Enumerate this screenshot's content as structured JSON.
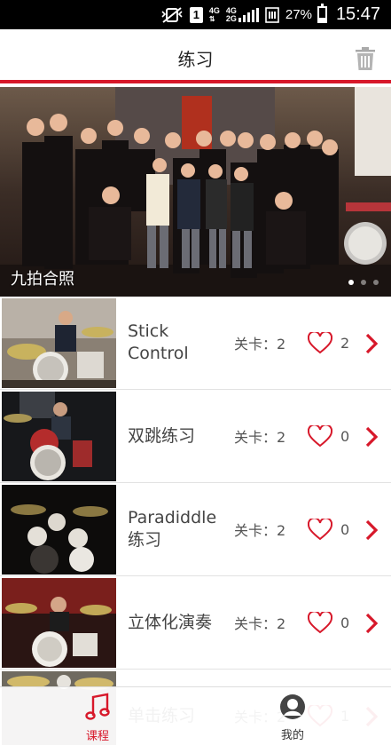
{
  "status_bar": {
    "sim_slot": "1",
    "network_top": "4G",
    "network_right_top": "4G",
    "network_right_bottom": "2G",
    "battery_percent": "27%",
    "time": "15:47",
    "battery_level": 0.27
  },
  "header": {
    "title": "练习",
    "trash_icon": "trash-icon"
  },
  "banner": {
    "caption": "九拍合照",
    "page_count": 3,
    "active_page": 1
  },
  "courses": [
    {
      "name": "Stick Control",
      "level_label": "关卡：2",
      "likes": "2"
    },
    {
      "name": "双跳练习",
      "level_label": "关卡：2",
      "likes": "0"
    },
    {
      "name": "Paradiddle 练习",
      "level_label": "关卡：2",
      "likes": "0"
    },
    {
      "name": "立体化演奏",
      "level_label": "关卡：2",
      "likes": "0"
    },
    {
      "name": "单击练习",
      "level_label": "关卡：2",
      "likes": "1"
    }
  ],
  "bottom_nav": {
    "course_label": "课程",
    "me_label": "我的",
    "active_tab": "course"
  },
  "colors": {
    "accent": "#d7182a",
    "text": "#444444"
  }
}
